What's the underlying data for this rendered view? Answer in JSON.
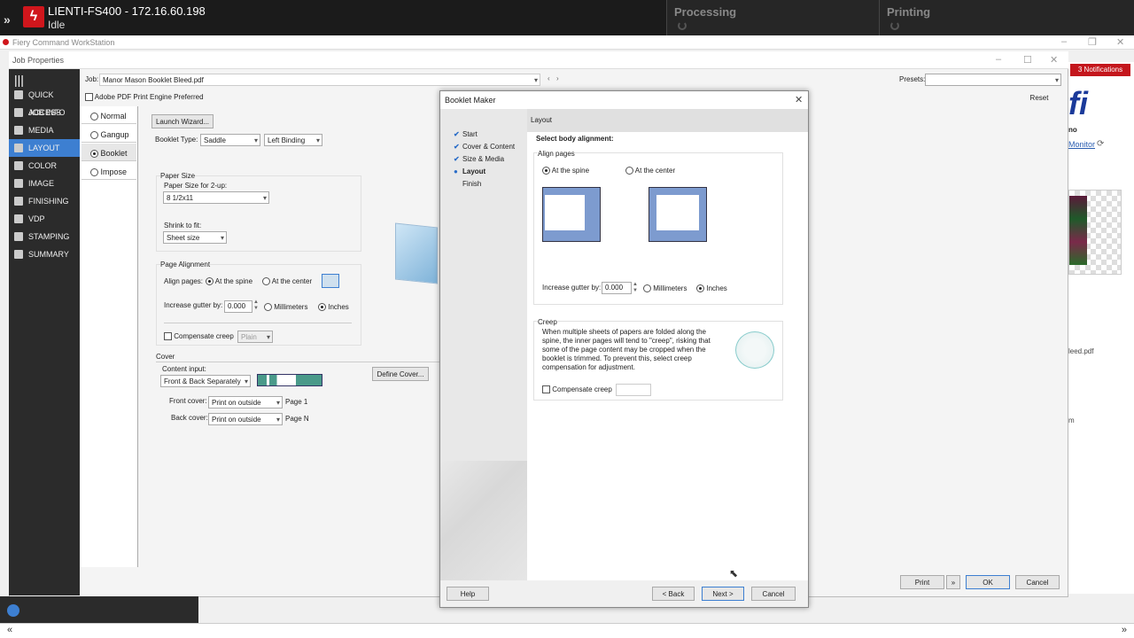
{
  "topbar": {
    "server": "LIENTI-FS400 - 172.16.60.198",
    "status": "Idle",
    "processing": "Processing",
    "printing": "Printing"
  },
  "cws": {
    "title": "Fiery Command WorkStation",
    "notifications": "3 Notifications",
    "monitor": "Monitor",
    "file_frag": "leed.pdf",
    "m_frag": "m",
    "no_frag": "no"
  },
  "jobprops": {
    "title": "Job Properties",
    "job_label": "Job:",
    "job_value": "Manor Mason Booklet Bleed.pdf",
    "presets_label": "Presets:",
    "reset": "Reset",
    "pdf_engine": "Adobe PDF Print Engine Preferred",
    "sidebar": [
      {
        "label": "QUICK ACCESS"
      },
      {
        "label": "JOB INFO"
      },
      {
        "label": "MEDIA"
      },
      {
        "label": "LAYOUT"
      },
      {
        "label": "COLOR"
      },
      {
        "label": "IMAGE"
      },
      {
        "label": "FINISHING"
      },
      {
        "label": "VDP"
      },
      {
        "label": "STAMPING"
      },
      {
        "label": "SUMMARY"
      }
    ],
    "layout_opts": [
      "Normal",
      "Gangup",
      "Booklet",
      "Impose"
    ],
    "launch_wizard": "Launch Wizard...",
    "booklet_type_label": "Booklet Type:",
    "booklet_type": "Saddle",
    "binding": "Left Binding",
    "paper_size_group": "Paper Size",
    "paper_size_label": "Paper Size for 2-up:",
    "paper_size": "8 1/2x11",
    "shrink_label": "Shrink to fit:",
    "shrink": "Sheet size",
    "page_alignment_group": "Page Alignment",
    "align_label": "Align pages:",
    "at_spine": "At the spine",
    "at_center": "At the center",
    "gutter_label": "Increase gutter by:",
    "gutter": "0.000",
    "mm": "Millimeters",
    "inches": "Inches",
    "compensate": "Compensate creep",
    "plain": "Plain",
    "cover_group": "Cover",
    "content_input_label": "Content input:",
    "content_input": "Front & Back Separately",
    "define_cover": "Define Cover...",
    "front_label": "Front cover:",
    "front_value": "Print on outside",
    "front_page": "Page 1",
    "back_label": "Back cover:",
    "back_value": "Print on outside",
    "back_page": "Page N",
    "print": "Print",
    "ok": "OK",
    "cancel": "Cancel"
  },
  "dialog": {
    "title": "Booklet Maker",
    "header": "Layout",
    "steps": [
      {
        "label": "Start",
        "state": "done"
      },
      {
        "label": "Cover & Content",
        "state": "done"
      },
      {
        "label": "Size & Media",
        "state": "done"
      },
      {
        "label": "Layout",
        "state": "current"
      },
      {
        "label": "Finish",
        "state": "pending"
      }
    ],
    "select_body": "Select body alignment:",
    "align_pages": "Align pages",
    "at_spine": "At the spine",
    "at_center": "At the center",
    "gutter_label": "Increase gutter by:",
    "gutter": "0.000",
    "mm": "Millimeters",
    "inches": "Inches",
    "creep_title": "Creep",
    "creep_text": "When multiple sheets of papers are folded along the spine, the inner pages will tend to \"creep\", risking that some of the page content may be cropped when the booklet is trimmed. To prevent this, select creep compensation for adjustment.",
    "compensate": "Compensate creep",
    "help": "Help",
    "back": "< Back",
    "next": "Next >",
    "cancel": "Cancel"
  },
  "colors": {
    "accent": "#3d7fd1",
    "brand": "#d0161c",
    "sidebar": "#2b2b2b"
  }
}
